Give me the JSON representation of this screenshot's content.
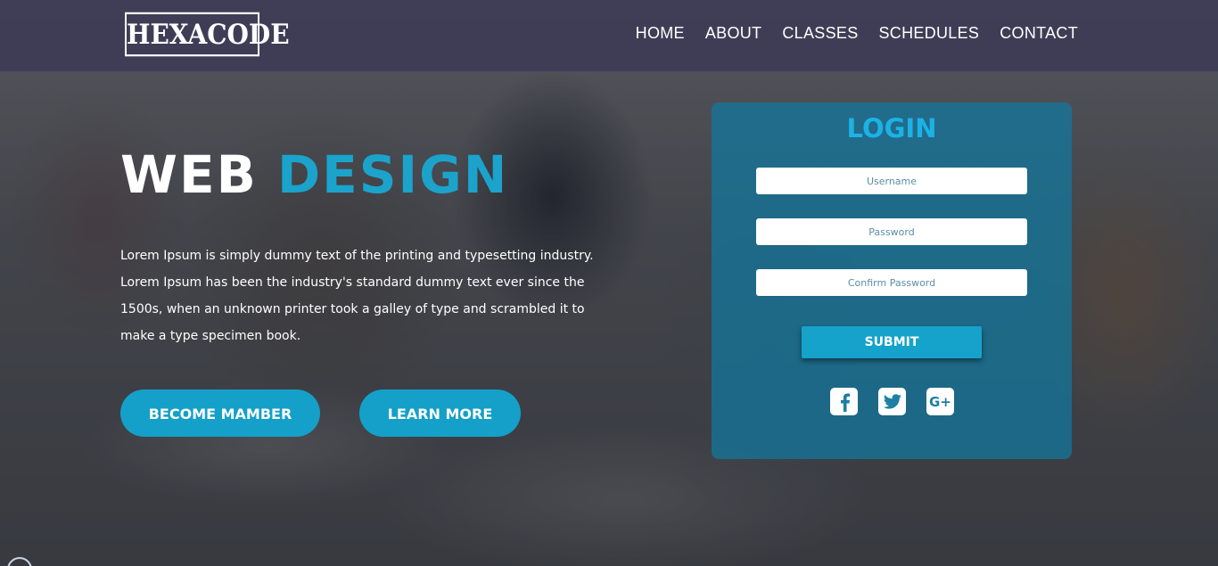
{
  "brand": {
    "logo_text": "HEXACODE"
  },
  "nav": {
    "items": [
      {
        "label": "HOME"
      },
      {
        "label": "ABOUT"
      },
      {
        "label": "CLASSES"
      },
      {
        "label": "SCHEDULES"
      },
      {
        "label": "CONTACT"
      }
    ]
  },
  "hero": {
    "title_main": "WEB",
    "title_accent": "DESIGN",
    "body": "Lorem Ipsum is simply dummy text of the printing and typesetting industry. Lorem Ipsum has been the industry's standard dummy text ever since the 1500s, when an unknown printer took a galley of type and scrambled it to make a type specimen book.",
    "primary_button": "BECOME MAMBER",
    "secondary_button": "LEARN MORE"
  },
  "login": {
    "title": "LOGIN",
    "username_placeholder": "Username",
    "password_placeholder": "Password",
    "confirm_placeholder": "Confirm Password",
    "submit_label": "SUBMIT",
    "socials": [
      {
        "icon": "facebook-icon"
      },
      {
        "icon": "twitter-icon"
      },
      {
        "icon": "google-plus-icon",
        "label": "G+"
      }
    ]
  },
  "colors": {
    "accent": "#1ba3cc",
    "navbar": "#3e3c56",
    "login_panel": "#1078a0"
  }
}
